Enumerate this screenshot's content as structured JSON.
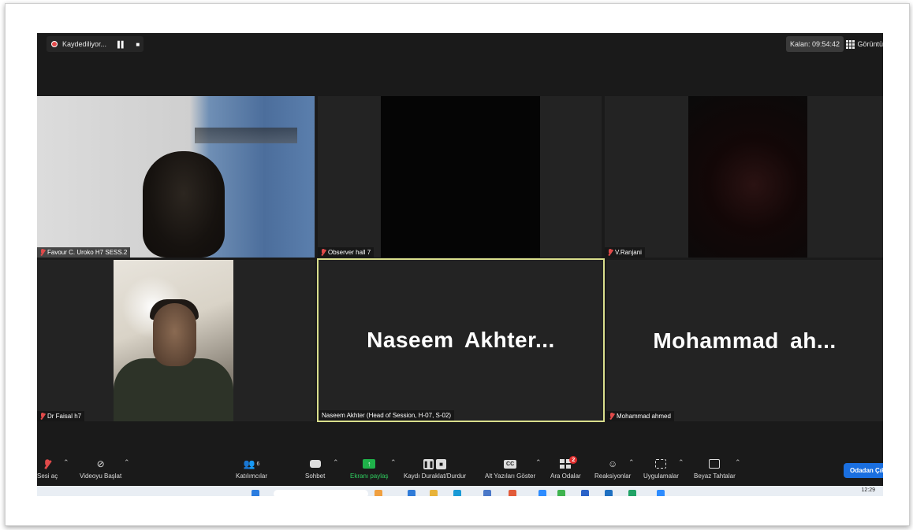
{
  "topbar": {
    "recording_label": "Kaydediliyor...",
    "timer": "Kalan: 09:54:42",
    "view_label": "Görüntü"
  },
  "tiles": [
    {
      "name": "Favour C. Uroko  H7 SESS.2"
    },
    {
      "name": "Observer hall 7"
    },
    {
      "name": "V.Ranjani"
    },
    {
      "name": "Dr Faisal h7"
    },
    {
      "name": "Naseem Akhter (Head of Session, H-07, S-02)",
      "big": "Naseem  Akhter..."
    },
    {
      "name": "Mohammad ahmed",
      "big": "Mohammad  ah..."
    }
  ],
  "toolbar": {
    "audio": "Sesi aç",
    "video": "Videoyu Başlat",
    "participants": "Katılımcılar",
    "participants_count": "6",
    "chat": "Sohbet",
    "share": "Ekranı paylaş",
    "record": "Kaydı Duraklat/Durdur",
    "captions": "Alt Yazıları Göster",
    "rooms": "Ara Odalar",
    "rooms_badge": "2",
    "reactions": "Reaksiyonlar",
    "apps": "Uygulamalar",
    "whiteboard": "Beyaz Tahtalar",
    "leave": "Odadan Çık"
  },
  "taskbar": {
    "clock": "12:29"
  },
  "colors": {
    "accent": "#1a6fe0",
    "share_green": "#1fb24a",
    "active_speaker": "#d9de8c",
    "muted_red": "#e04a4a"
  }
}
